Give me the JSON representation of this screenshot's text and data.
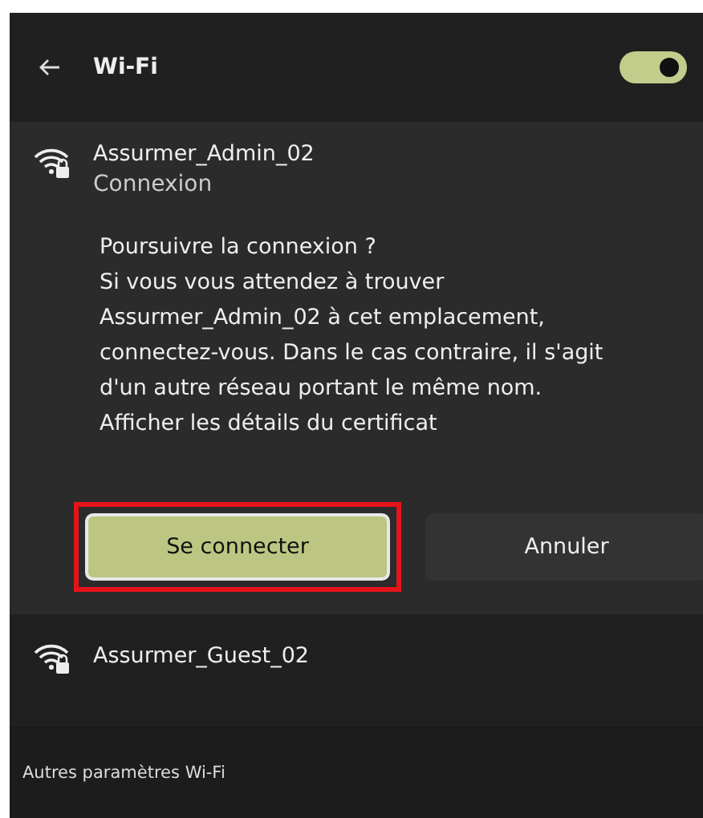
{
  "header": {
    "title": "Wi-Fi",
    "wifi_on": true
  },
  "networks": [
    {
      "name": "Assurmer_Admin_02",
      "status": "Connexion",
      "expanded": true,
      "secured": true,
      "message": "Poursuivre la connexion ?\nSi vous vous attendez à trouver\nAssurmer_Admin_02 à cet emplacement,\nconnectez-vous. Dans le cas contraire, il s'agit\nd'un autre réseau portant le même nom.",
      "link": "Afficher les détails du certificat",
      "buttons": [
        {
          "label": "Se connecter",
          "kind": "primary",
          "highlighted": true
        },
        {
          "label": "Annuler",
          "kind": "secondary",
          "highlighted": false
        }
      ]
    },
    {
      "name": "Assurmer_Guest_02",
      "expanded": false,
      "secured": true
    }
  ],
  "footer": {
    "link": "Autres paramètres Wi-Fi"
  }
}
